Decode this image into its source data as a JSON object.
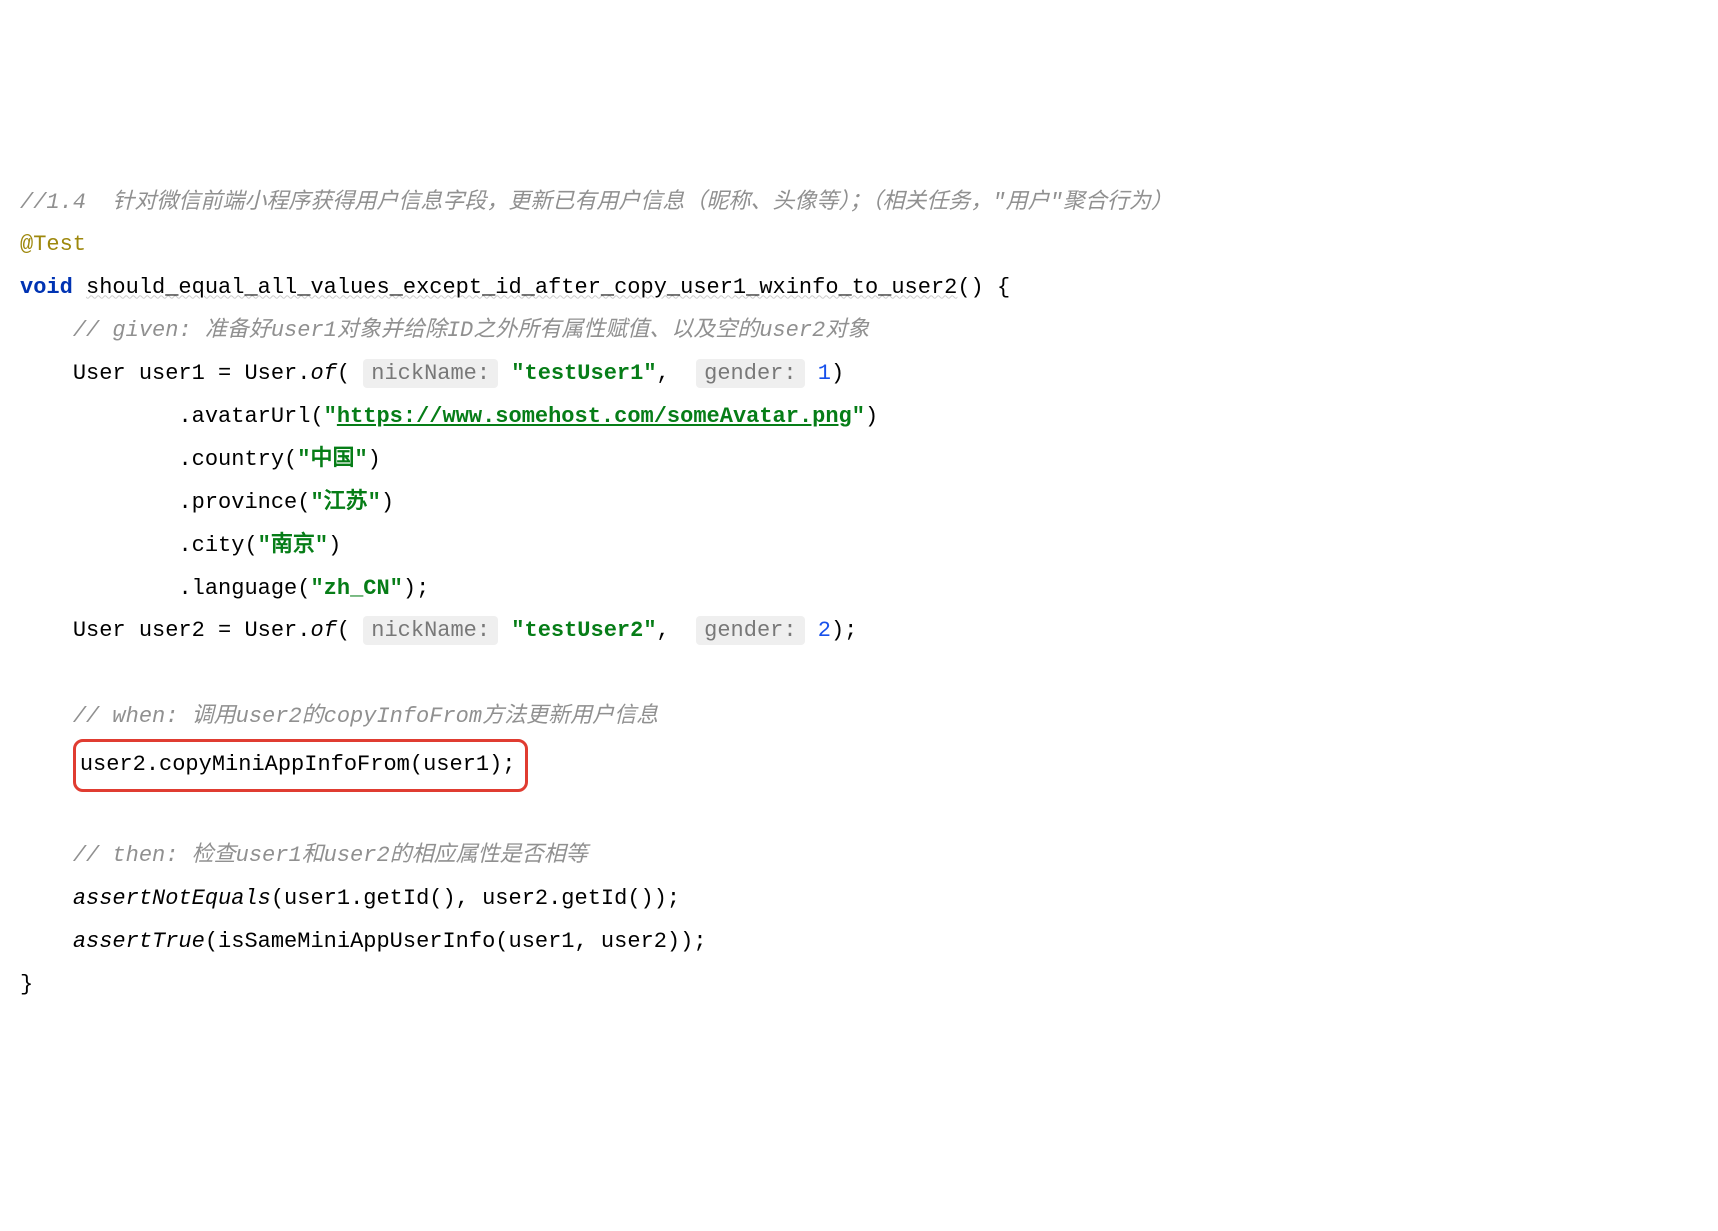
{
  "code": {
    "line1_comment": "//1.4  针对微信前端小程序获得用户信息字段，更新已有用户信息（昵称、头像等）；（相关任务，\"用户\"聚合行为）",
    "line2_annotation": "@Test",
    "line3_keyword": "void",
    "line3_method": "should_equal_all_values_except_id_after_copy_user1_wxinfo_to_user2",
    "line3_suffix": "() {",
    "line4_comment": "// given: 准备好user1对象并给除ID之外所有属性赋值、以及空的user2对象",
    "line5_prefix": "User user1 = User.",
    "line5_of": "of",
    "line5_open": "( ",
    "line5_hint1": "nickName:",
    "line5_str1": "\"testUser1\"",
    "line5_comma": ",  ",
    "line5_hint2": "gender:",
    "line5_num": "1",
    "line5_close": ")",
    "line6_method": ".avatarUrl(",
    "line6_quote_open": "\"",
    "line6_url": "https://www.somehost.com/someAvatar.png",
    "line6_quote_close": "\"",
    "line6_close": ")",
    "line7_method": ".country(",
    "line7_str": "\"中国\"",
    "line7_close": ")",
    "line8_method": ".province(",
    "line8_str": "\"江苏\"",
    "line8_close": ")",
    "line9_method": ".city(",
    "line9_str": "\"南京\"",
    "line9_close": ")",
    "line10_method": ".language(",
    "line10_str": "\"zh_CN\"",
    "line10_close": ");",
    "line11_prefix": "User user2 = User.",
    "line11_of": "of",
    "line11_open": "( ",
    "line11_hint1": "nickName:",
    "line11_str1": "\"testUser2\"",
    "line11_comma": ",  ",
    "line11_hint2": "gender:",
    "line11_num": "2",
    "line11_close": ");",
    "line13_comment": "// when: 调用user2的copyInfoFrom方法更新用户信息",
    "line14_code": "user2.copyMiniAppInfoFrom(user1);",
    "line16_comment": "// then: 检查user1和user2的相应属性是否相等",
    "line17_assert": "assertNotEquals",
    "line17_args": "(user1.getId(), user2.getId());",
    "line18_assert": "assertTrue",
    "line18_args": "(isSameMiniAppUserInfo(user1, user2));",
    "line19": "}"
  }
}
